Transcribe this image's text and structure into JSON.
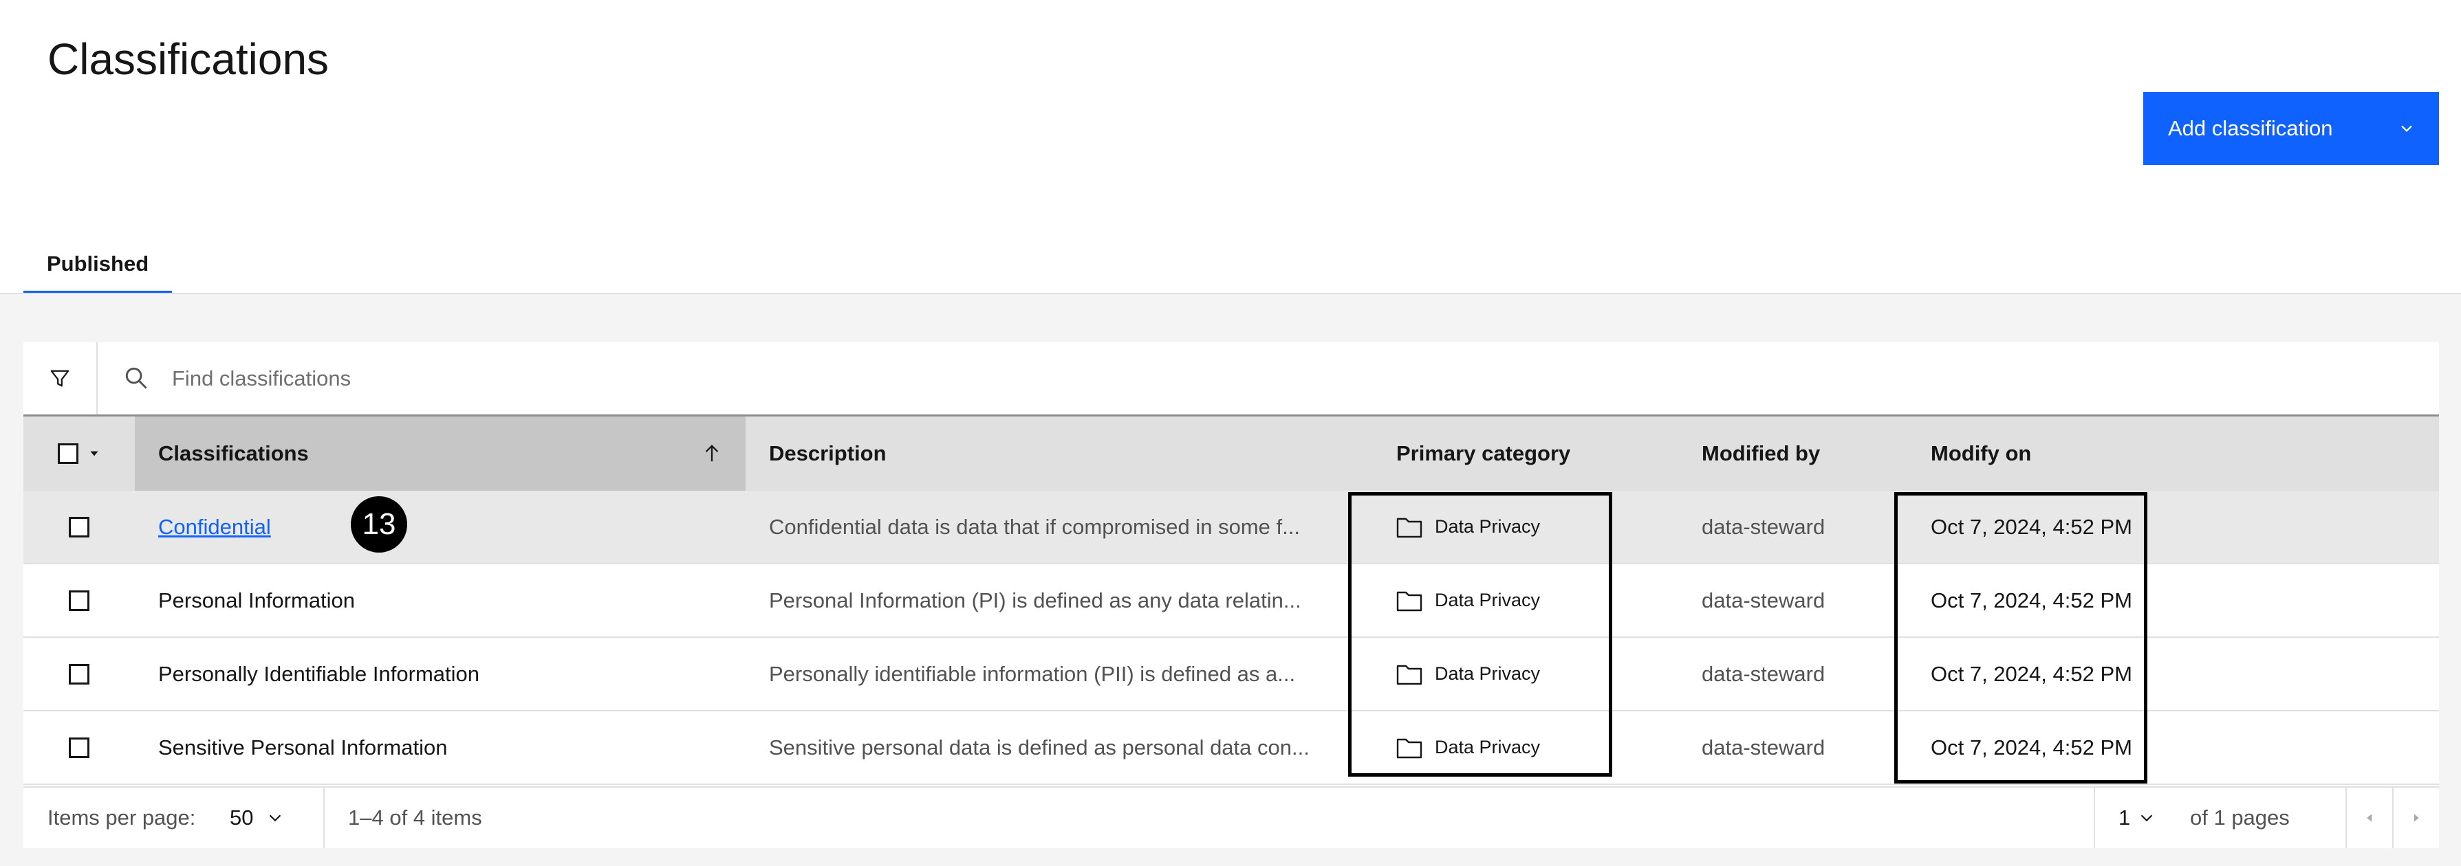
{
  "page": {
    "title": "Classifications"
  },
  "actions": {
    "add_label": "Add classification"
  },
  "tabs": [
    {
      "label": "Published",
      "active": true
    }
  ],
  "search": {
    "placeholder": "Find classifications"
  },
  "table": {
    "headers": {
      "name": "Classifications",
      "description": "Description",
      "primary_category": "Primary category",
      "modified_by": "Modified by",
      "modify_on": "Modify on"
    },
    "sort": {
      "column": "Classifications",
      "direction": "ascending"
    },
    "rows": [
      {
        "name": "Confidential",
        "is_link": true,
        "description": "Confidential data is data that if compromised in some f...",
        "primary_category": "Data Privacy",
        "modified_by": "data-steward",
        "modify_on": "Oct 7, 2024, 4:52 PM"
      },
      {
        "name": "Personal Information",
        "is_link": false,
        "description": "Personal Information (PI) is defined as any data relatin...",
        "primary_category": "Data Privacy",
        "modified_by": "data-steward",
        "modify_on": "Oct 7, 2024, 4:52 PM"
      },
      {
        "name": "Personally Identifiable Information",
        "is_link": false,
        "description": "Personally identifiable information (PII) is defined as a...",
        "primary_category": "Data Privacy",
        "modified_by": "data-steward",
        "modify_on": "Oct 7, 2024, 4:52 PM"
      },
      {
        "name": "Sensitive Personal Information",
        "is_link": false,
        "description": "Sensitive personal data is defined as personal data con...",
        "primary_category": "Data Privacy",
        "modified_by": "data-steward",
        "modify_on": "Oct 7, 2024, 4:52 PM"
      }
    ]
  },
  "annotation": {
    "badge": "13"
  },
  "pagination": {
    "items_per_page_label": "Items per page:",
    "items_per_page": "50",
    "range": "1–4 of 4 items",
    "page": "1",
    "of_pages": "of 1 pages"
  },
  "colors": {
    "accent": "#0f62fe",
    "header_bg": "#e0e0e0",
    "sorted_header_bg": "#c6c6c6",
    "page_bg": "#f4f4f4"
  },
  "icons": {
    "filter": "filter-icon",
    "search": "search-icon",
    "sort": "arrow-up-icon",
    "category": "folder-icon",
    "dropdown": "chevron-down-icon",
    "prev": "caret-left-icon",
    "next": "caret-right-icon"
  }
}
